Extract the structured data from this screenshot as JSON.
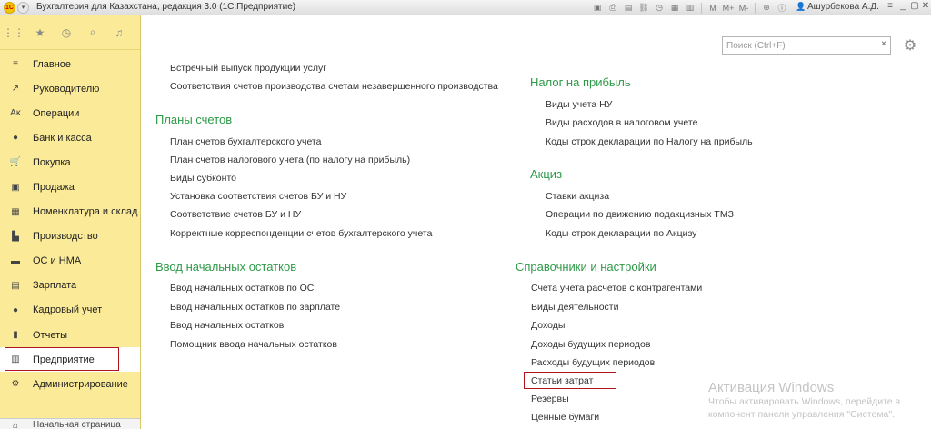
{
  "window": {
    "title": "Бухгалтерия для Казахстана, редакция 3.0  (1С:Предприятие)",
    "logo": "1С",
    "user": "Ашурбекова А.Д.",
    "toolbar_icons": [
      "save-icon",
      "print-icon",
      "preview-icon",
      "link-icon",
      "history-icon",
      "calendar-icon",
      "calculator-icon",
      "memory-icon"
    ],
    "memory_buttons": [
      "M",
      "M+",
      "M-"
    ],
    "zoom_icon": "zoom-icon",
    "info_icon": "info-icon"
  },
  "sidebar": {
    "top_icons": [
      "apps-icon",
      "star-icon",
      "history-icon",
      "search-icon",
      "bell-icon"
    ],
    "items": [
      {
        "label": "Главное",
        "icon": "menu-icon",
        "glyph": "≡"
      },
      {
        "label": "Руководителю",
        "icon": "chart-icon",
        "glyph": "↗"
      },
      {
        "label": "Операции",
        "icon": "operations-icon",
        "glyph": "Aᴋ"
      },
      {
        "label": "Банк и касса",
        "icon": "bank-icon",
        "glyph": "●"
      },
      {
        "label": "Покупка",
        "icon": "cart-icon",
        "glyph": "🛒"
      },
      {
        "label": "Продажа",
        "icon": "bag-icon",
        "glyph": "▣"
      },
      {
        "label": "Номенклатура и склад",
        "icon": "warehouse-icon",
        "glyph": "▦"
      },
      {
        "label": "Производство",
        "icon": "factory-icon",
        "glyph": "▙"
      },
      {
        "label": "ОС и НМА",
        "icon": "truck-icon",
        "glyph": "▬"
      },
      {
        "label": "Зарплата",
        "icon": "salary-icon",
        "glyph": "▤"
      },
      {
        "label": "Кадровый учет",
        "icon": "person-icon",
        "glyph": "●"
      },
      {
        "label": "Отчеты",
        "icon": "reports-icon",
        "glyph": "▮"
      },
      {
        "label": "Предприятие",
        "icon": "building-icon",
        "glyph": "▥",
        "active": true
      },
      {
        "label": "Администрирование",
        "icon": "gear-icon",
        "glyph": "⚙"
      }
    ],
    "bottom": {
      "label": "Начальная страница",
      "icon": "home-icon"
    }
  },
  "search": {
    "placeholder": "Поиск (Ctrl+F)",
    "clear": "×"
  },
  "content": {
    "col1": {
      "top_links": [
        "Встречный выпуск продукции услуг",
        "Соответствия счетов производства счетам незавершенного производства"
      ],
      "sections": [
        {
          "title": "Планы счетов",
          "links": [
            "План счетов бухгалтерского учета",
            "План счетов налогового учета (по налогу на прибыль)",
            "Виды субконто",
            "Установка соответствия счетов БУ и НУ",
            "Соответствие счетов БУ и НУ",
            "Корректные корреспонденции счетов бухгалтерского учета"
          ]
        },
        {
          "title": "Ввод начальных остатков",
          "links": [
            "Ввод начальных остатков по ОС",
            "Ввод начальных остатков по зарплате",
            "Ввод начальных остатков",
            "Помощник ввода начальных остатков"
          ]
        }
      ]
    },
    "col2": {
      "sections": [
        {
          "title": "Налог на прибыль",
          "links": [
            "Виды учета НУ",
            "Виды расходов в налоговом учете",
            "Коды строк декларации по Налогу на прибыль"
          ]
        },
        {
          "title": "Акциз",
          "links": [
            "Ставки акциза",
            "Операции по движению подакцизных ТМЗ",
            "Коды строк декларации по Акцизу"
          ]
        }
      ]
    },
    "col3": {
      "title": "Справочники и настройки",
      "links": [
        "Счета учета расчетов с контрагентами",
        "Виды деятельности",
        "Доходы",
        "Доходы будущих периодов",
        "Расходы будущих периодов",
        "Статьи затрат",
        "Резервы",
        "Ценные бумаги"
      ]
    }
  },
  "watermark": {
    "title": "Активация Windows",
    "line1": "Чтобы активировать Windows, перейдите в",
    "line2": "компонент панели управления \"Система\"."
  },
  "colors": {
    "sidebar_bg": "#fbeb98",
    "section_title": "#2d9a47",
    "highlight": "#b3141b"
  }
}
